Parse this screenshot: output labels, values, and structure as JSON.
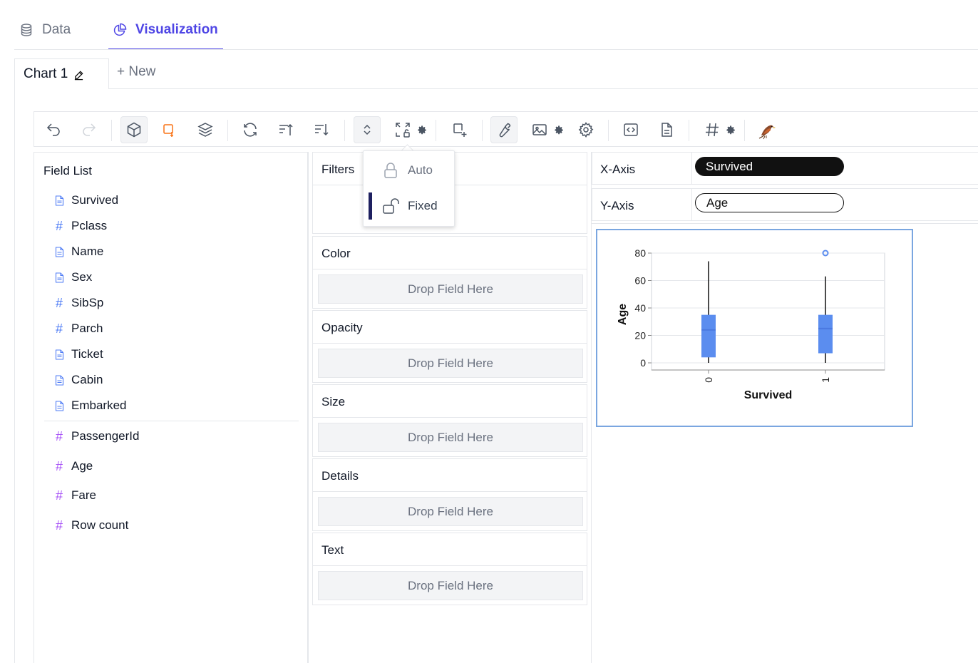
{
  "top_tabs": {
    "data": "Data",
    "visualization": "Visualization"
  },
  "chart_tabs": {
    "active": "Chart 1",
    "new": "+ New"
  },
  "popup": {
    "items": [
      {
        "label": "Auto"
      },
      {
        "label": "Fixed"
      }
    ],
    "selected": "Fixed"
  },
  "field_list": {
    "title": "Field List",
    "dimensions": [
      {
        "name": "Survived",
        "icon": "document-icon"
      },
      {
        "name": "Pclass",
        "icon": "hash-icon"
      },
      {
        "name": "Name",
        "icon": "document-icon"
      },
      {
        "name": "Sex",
        "icon": "document-icon"
      },
      {
        "name": "SibSp",
        "icon": "hash-icon"
      },
      {
        "name": "Parch",
        "icon": "hash-icon"
      },
      {
        "name": "Ticket",
        "icon": "document-icon"
      },
      {
        "name": "Cabin",
        "icon": "document-icon"
      },
      {
        "name": "Embarked",
        "icon": "document-icon"
      }
    ],
    "measures": [
      {
        "name": "PassengerId",
        "icon": "hash-icon"
      },
      {
        "name": "Age",
        "icon": "hash-icon"
      },
      {
        "name": "Fare",
        "icon": "hash-icon"
      },
      {
        "name": "Row count",
        "icon": "hash-icon"
      }
    ]
  },
  "encodings": {
    "filters": "Filters",
    "drop_placeholder": "Drop Field Here",
    "channels": [
      "Color",
      "Opacity",
      "Size",
      "Details",
      "Text"
    ]
  },
  "axes": {
    "x_label": "X-Axis",
    "x_field": "Survived",
    "y_label": "Y-Axis",
    "y_field": "Age"
  },
  "colors": {
    "accent": "#4f46e5",
    "box": "#5b8def",
    "outlier": "#5b8def"
  },
  "chart_data": {
    "type": "boxplot",
    "xlabel": "Survived",
    "ylabel": "Age",
    "categories": [
      "0",
      "1"
    ],
    "ylim": [
      0,
      85
    ],
    "yticks": [
      0,
      20,
      40,
      60,
      80
    ],
    "boxes": [
      {
        "category": "0",
        "min": 0,
        "q1": 4,
        "median": 24,
        "q3": 35,
        "max": 74
      },
      {
        "category": "1",
        "min": 0,
        "q1": 7,
        "median": 25,
        "q3": 35,
        "max": 63
      }
    ],
    "outliers": [
      {
        "category": "1",
        "value": 80
      }
    ],
    "grid": true
  }
}
